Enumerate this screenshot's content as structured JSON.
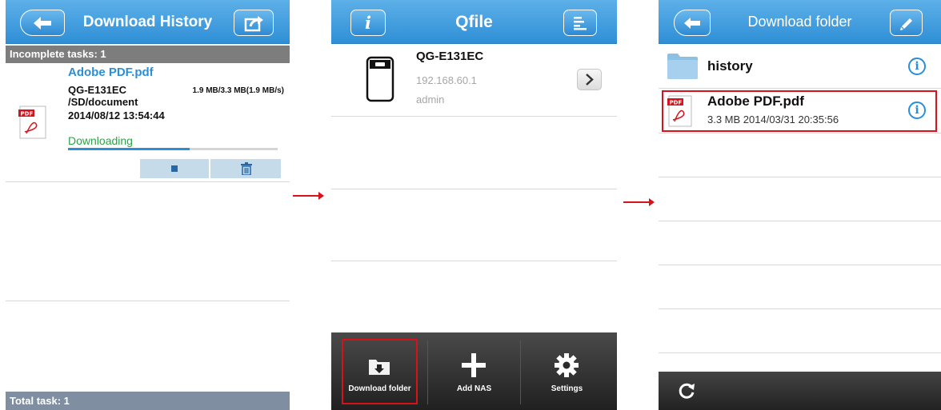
{
  "screen1": {
    "title": "Download History",
    "section_header": "Incomplete tasks: 1",
    "task": {
      "file_name": "Adobe PDF.pdf",
      "nas": "QG-E131EC",
      "path": "/SD/document",
      "datetime": "2014/08/12 13:54:44",
      "size_progress": "1.9 MB/3.3 MB(1.9 MB/s)",
      "status": "Downloading",
      "progress": 0.58
    },
    "footer": "Total task: 1"
  },
  "screen2": {
    "title": "Qfile",
    "nas": {
      "name": "QG-E131EC",
      "ip": "192.168.60.1",
      "user": "admin"
    },
    "tabs": [
      {
        "label": "Download folder",
        "icon": "download-folder-icon"
      },
      {
        "label": "Add NAS",
        "icon": "plus-icon"
      },
      {
        "label": "Settings",
        "icon": "gear-icon"
      }
    ]
  },
  "screen3": {
    "title": "Download folder",
    "items": [
      {
        "name": "history",
        "type": "folder"
      },
      {
        "name": "Adobe PDF.pdf",
        "meta": "3.3 MB 2014/03/31 20:35:56",
        "type": "pdf"
      }
    ]
  },
  "colors": {
    "navbar": "#2f8fd6",
    "accent": "#2a8fd8",
    "highlight": "#d8121b",
    "status_green": "#2ea34a"
  }
}
